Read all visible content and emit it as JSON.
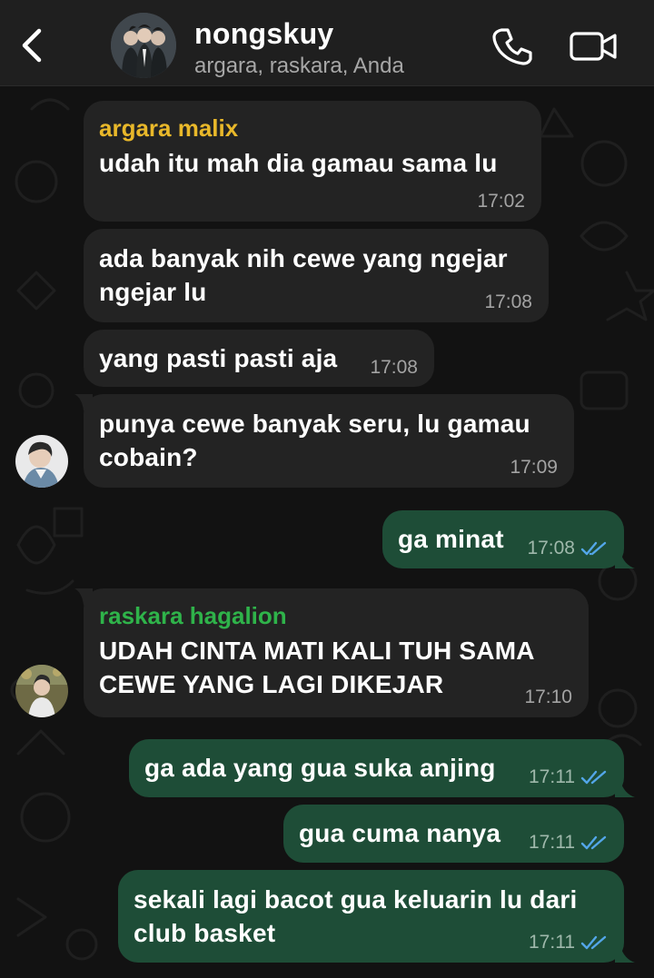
{
  "header": {
    "title": "nongskuy",
    "members": "argara, raskara, Anda"
  },
  "colors": {
    "incoming_bubble": "#232323",
    "outgoing_bubble": "#1e4d37",
    "sender_argara": "#e9b82a",
    "sender_raskara": "#2fb34a",
    "read_ticks": "#53a6e8"
  },
  "icons": {
    "back": "back-arrow-icon",
    "call": "phone-icon",
    "video": "video-camera-icon"
  },
  "messages": [
    {
      "direction": "in",
      "sender": "argara malix",
      "text": "udah itu mah dia gamau sama lu",
      "time": "17:02"
    },
    {
      "direction": "in",
      "text_lines": [
        "ada banyak nih cewe yang ngejar",
        "ngejar lu"
      ],
      "time": "17:08"
    },
    {
      "direction": "in",
      "text": "yang pasti pasti aja",
      "time": "17:08"
    },
    {
      "direction": "in",
      "text_lines": [
        "punya cewe banyak seru, lu gamau",
        "cobain?"
      ],
      "time": "17:09"
    },
    {
      "direction": "out",
      "text": "ga minat",
      "time": "17:08",
      "status": "read"
    },
    {
      "direction": "in",
      "sender": "raskara hagalion",
      "text_lines": [
        "UDAH CINTA MATI KALI TUH SAMA",
        "CEWE YANG LAGI DIKEJAR"
      ],
      "time": "17:10"
    },
    {
      "direction": "out",
      "text": "ga ada yang gua suka anjing",
      "time": "17:11",
      "status": "read"
    },
    {
      "direction": "out",
      "text": "gua cuma nanya",
      "time": "17:11",
      "status": "read"
    },
    {
      "direction": "out",
      "text_lines": [
        "sekali lagi bacot gua keluarin lu dari",
        "club basket"
      ],
      "time": "17:11",
      "status": "read"
    }
  ]
}
